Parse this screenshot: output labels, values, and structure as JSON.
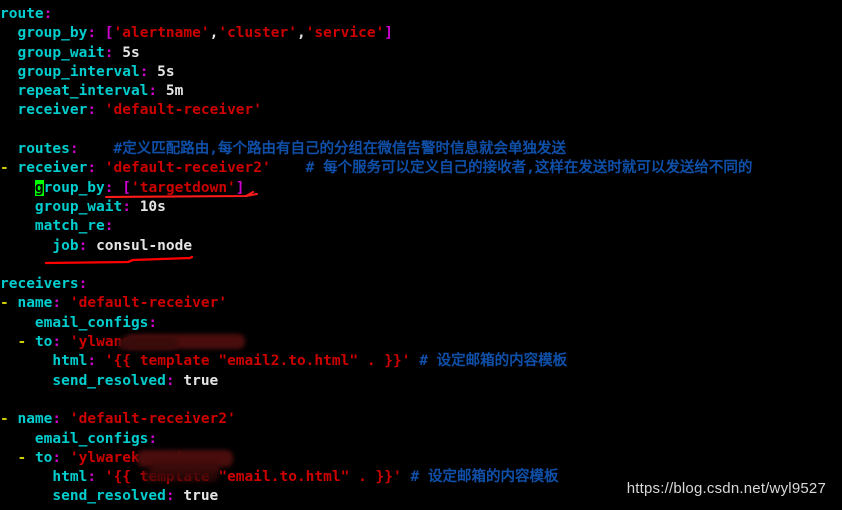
{
  "editor": {
    "background": "#000000",
    "cursor_color": "#00ff00",
    "key_color": "#00cdcd",
    "string_color": "#cd0000",
    "bracket_color": "#cd00cd",
    "comment_color": "#1560bd",
    "dash_color": "#cdcd00",
    "plain_color": "#e5e5e5",
    "annotation_red": "#ff0000",
    "annotation_magenta": "#ff00cc"
  },
  "lines": [
    {
      "id": "line-route",
      "indent": 0,
      "key": "route",
      "value": ""
    },
    {
      "id": "line-group-by",
      "indent": 1,
      "key": "group_by",
      "value": "['alertname','cluster','service']"
    },
    {
      "id": "line-group-wait",
      "indent": 1,
      "key": "group_wait",
      "value": "5s"
    },
    {
      "id": "line-group-interval",
      "indent": 1,
      "key": "group_interval",
      "value": "5s"
    },
    {
      "id": "line-repeat-interval",
      "indent": 1,
      "key": "repeat_interval",
      "value": "5m"
    },
    {
      "id": "line-receiver",
      "indent": 1,
      "key": "receiver",
      "value": "'default-receiver'"
    },
    {
      "id": "line-blank-1",
      "indent": 0,
      "key": "",
      "value": ""
    },
    {
      "id": "line-routes",
      "indent": 1,
      "key": "routes",
      "value": "",
      "comment": "#定义匹配路由,每个路由有自己的分组在微信告警时信息就会单独发送"
    },
    {
      "id": "line-routes-receiver",
      "indent": 1,
      "key": "receiver",
      "value": "'default-receiver2'",
      "list": true,
      "comment": "# 每个服务可以定义自己的接收者,这样在发送时就可以发送给不同的"
    },
    {
      "id": "line-routes-group-by",
      "indent": 2,
      "key": "group_by",
      "value": "['targetdown']",
      "cursor": true,
      "underline": "magenta"
    },
    {
      "id": "line-routes-group-wait",
      "indent": 2,
      "key": "group_wait",
      "value": "10s"
    },
    {
      "id": "line-match-re",
      "indent": 2,
      "key": "match_re",
      "value": ""
    },
    {
      "id": "line-job",
      "indent": 3,
      "key": "job",
      "value": "consul-node",
      "underline": "red"
    },
    {
      "id": "line-blank-2",
      "indent": 0,
      "key": "",
      "value": ""
    },
    {
      "id": "line-receivers",
      "indent": 0,
      "key": "receivers",
      "value": ""
    },
    {
      "id": "line-name-1",
      "indent": 1,
      "key": "name",
      "value": "'default-receiver'",
      "list": true
    },
    {
      "id": "line-email-configs-1",
      "indent": 2,
      "key": "email_configs",
      "value": ""
    },
    {
      "id": "line-to-1",
      "indent": 2,
      "key": "to",
      "value": "'ylwan",
      "value_tail": "om'",
      "list": true,
      "redacted": true
    },
    {
      "id": "line-html-1",
      "indent": 3,
      "key": "html",
      "value": "'{{ template \"email2.to.html\" . }}'",
      "comment": "# 设定邮箱的内容模板"
    },
    {
      "id": "line-send-resolved-1",
      "indent": 3,
      "key": "send_resolved",
      "value": "true"
    },
    {
      "id": "line-blank-3",
      "indent": 0,
      "key": "",
      "value": ""
    },
    {
      "id": "line-name-2",
      "indent": 1,
      "key": "name",
      "value": "'default-receiver2'",
      "list": true
    },
    {
      "id": "line-email-configs-2",
      "indent": 2,
      "key": "email_configs",
      "value": ""
    },
    {
      "id": "line-to-2",
      "indent": 2,
      "key": "to",
      "value": "'ylwar",
      "value_tail": "ek.com'",
      "list": true,
      "redacted": true
    },
    {
      "id": "line-html-2",
      "indent": 3,
      "key": "html",
      "value": "'{{ template \"email.to.html\" . }}'",
      "comment": "# 设定邮箱的内容模板"
    },
    {
      "id": "line-send-resolved-2",
      "indent": 3,
      "key": "send_resolved",
      "value": "true"
    }
  ],
  "watermark": {
    "text": "https://blog.csdn.net/wyl9527"
  }
}
